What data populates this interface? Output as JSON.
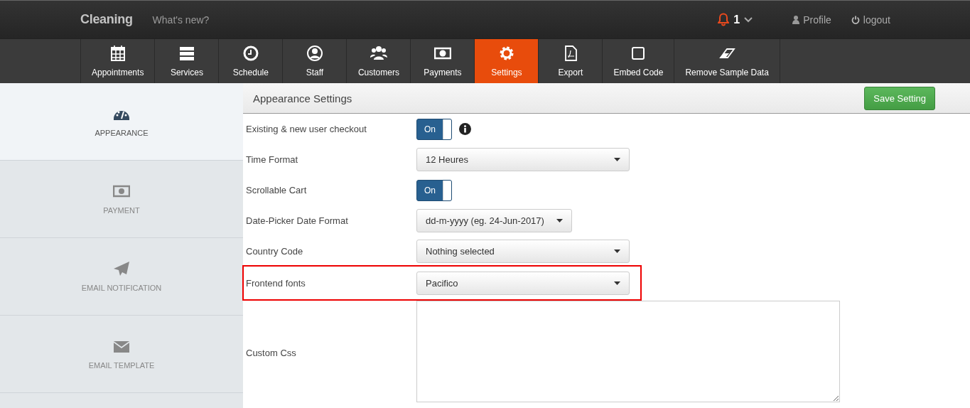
{
  "topbar": {
    "brand": "Cleaning",
    "link": "What's new?",
    "notifications": "1",
    "profile": "Profile",
    "logout": "logout"
  },
  "nav": [
    {
      "label": "Appointments",
      "selected": false
    },
    {
      "label": "Services",
      "selected": false
    },
    {
      "label": "Schedule",
      "selected": false
    },
    {
      "label": "Staff",
      "selected": false
    },
    {
      "label": "Customers",
      "selected": false
    },
    {
      "label": "Payments",
      "selected": false
    },
    {
      "label": "Settings",
      "selected": true
    },
    {
      "label": "Export",
      "selected": false
    },
    {
      "label": "Embed Code",
      "selected": false
    },
    {
      "label": "Remove Sample Data",
      "selected": false
    }
  ],
  "sidebar": [
    {
      "label": "APPEARANCE",
      "selected": true
    },
    {
      "label": "PAYMENT",
      "selected": false
    },
    {
      "label": "EMAIL NOTIFICATION",
      "selected": false
    },
    {
      "label": "EMAIL TEMPLATE",
      "selected": false
    }
  ],
  "panel": {
    "title": "Appearance Settings",
    "save": "Save Setting"
  },
  "rows": [
    {
      "kind": "toggle",
      "label": "Existing & new user checkout",
      "on": true,
      "toggle_label": "On",
      "info": true,
      "highlighted": false
    },
    {
      "kind": "select",
      "label": "Time Format",
      "value": "12 Heures",
      "highlighted": false
    },
    {
      "kind": "toggle",
      "label": "Scrollable Cart",
      "on": true,
      "toggle_label": "On",
      "info": false,
      "highlighted": false
    },
    {
      "kind": "select",
      "label": "Date-Picker Date Format",
      "value": "dd-m-yyyy (eg. 24-Jun-2017)",
      "compact": true,
      "highlighted": false
    },
    {
      "kind": "select",
      "label": "Country Code",
      "value": "Nothing selected",
      "highlighted": false
    },
    {
      "kind": "select",
      "label": "Frontend fonts",
      "value": "Pacifico",
      "highlighted": true
    },
    {
      "kind": "textarea",
      "label": "Custom Css",
      "highlighted": false
    }
  ]
}
